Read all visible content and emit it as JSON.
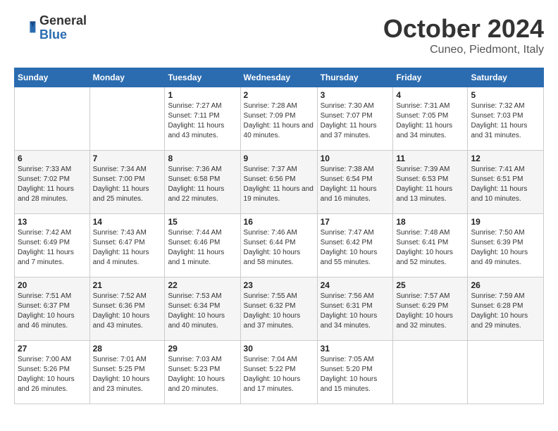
{
  "header": {
    "logo_general": "General",
    "logo_blue": "Blue",
    "title": "October 2024",
    "location": "Cuneo, Piedmont, Italy"
  },
  "weekdays": [
    "Sunday",
    "Monday",
    "Tuesday",
    "Wednesday",
    "Thursday",
    "Friday",
    "Saturday"
  ],
  "weeks": [
    [
      {
        "day": null
      },
      {
        "day": null
      },
      {
        "day": "1",
        "sunrise": "7:27 AM",
        "sunset": "7:11 PM",
        "daylight": "11 hours and 43 minutes."
      },
      {
        "day": "2",
        "sunrise": "7:28 AM",
        "sunset": "7:09 PM",
        "daylight": "11 hours and 40 minutes."
      },
      {
        "day": "3",
        "sunrise": "7:30 AM",
        "sunset": "7:07 PM",
        "daylight": "11 hours and 37 minutes."
      },
      {
        "day": "4",
        "sunrise": "7:31 AM",
        "sunset": "7:05 PM",
        "daylight": "11 hours and 34 minutes."
      },
      {
        "day": "5",
        "sunrise": "7:32 AM",
        "sunset": "7:03 PM",
        "daylight": "11 hours and 31 minutes."
      }
    ],
    [
      {
        "day": "6",
        "sunrise": "7:33 AM",
        "sunset": "7:02 PM",
        "daylight": "11 hours and 28 minutes."
      },
      {
        "day": "7",
        "sunrise": "7:34 AM",
        "sunset": "7:00 PM",
        "daylight": "11 hours and 25 minutes."
      },
      {
        "day": "8",
        "sunrise": "7:36 AM",
        "sunset": "6:58 PM",
        "daylight": "11 hours and 22 minutes."
      },
      {
        "day": "9",
        "sunrise": "7:37 AM",
        "sunset": "6:56 PM",
        "daylight": "11 hours and 19 minutes."
      },
      {
        "day": "10",
        "sunrise": "7:38 AM",
        "sunset": "6:54 PM",
        "daylight": "11 hours and 16 minutes."
      },
      {
        "day": "11",
        "sunrise": "7:39 AM",
        "sunset": "6:53 PM",
        "daylight": "11 hours and 13 minutes."
      },
      {
        "day": "12",
        "sunrise": "7:41 AM",
        "sunset": "6:51 PM",
        "daylight": "11 hours and 10 minutes."
      }
    ],
    [
      {
        "day": "13",
        "sunrise": "7:42 AM",
        "sunset": "6:49 PM",
        "daylight": "11 hours and 7 minutes."
      },
      {
        "day": "14",
        "sunrise": "7:43 AM",
        "sunset": "6:47 PM",
        "daylight": "11 hours and 4 minutes."
      },
      {
        "day": "15",
        "sunrise": "7:44 AM",
        "sunset": "6:46 PM",
        "daylight": "11 hours and 1 minute."
      },
      {
        "day": "16",
        "sunrise": "7:46 AM",
        "sunset": "6:44 PM",
        "daylight": "10 hours and 58 minutes."
      },
      {
        "day": "17",
        "sunrise": "7:47 AM",
        "sunset": "6:42 PM",
        "daylight": "10 hours and 55 minutes."
      },
      {
        "day": "18",
        "sunrise": "7:48 AM",
        "sunset": "6:41 PM",
        "daylight": "10 hours and 52 minutes."
      },
      {
        "day": "19",
        "sunrise": "7:50 AM",
        "sunset": "6:39 PM",
        "daylight": "10 hours and 49 minutes."
      }
    ],
    [
      {
        "day": "20",
        "sunrise": "7:51 AM",
        "sunset": "6:37 PM",
        "daylight": "10 hours and 46 minutes."
      },
      {
        "day": "21",
        "sunrise": "7:52 AM",
        "sunset": "6:36 PM",
        "daylight": "10 hours and 43 minutes."
      },
      {
        "day": "22",
        "sunrise": "7:53 AM",
        "sunset": "6:34 PM",
        "daylight": "10 hours and 40 minutes."
      },
      {
        "day": "23",
        "sunrise": "7:55 AM",
        "sunset": "6:32 PM",
        "daylight": "10 hours and 37 minutes."
      },
      {
        "day": "24",
        "sunrise": "7:56 AM",
        "sunset": "6:31 PM",
        "daylight": "10 hours and 34 minutes."
      },
      {
        "day": "25",
        "sunrise": "7:57 AM",
        "sunset": "6:29 PM",
        "daylight": "10 hours and 32 minutes."
      },
      {
        "day": "26",
        "sunrise": "7:59 AM",
        "sunset": "6:28 PM",
        "daylight": "10 hours and 29 minutes."
      }
    ],
    [
      {
        "day": "27",
        "sunrise": "7:00 AM",
        "sunset": "5:26 PM",
        "daylight": "10 hours and 26 minutes."
      },
      {
        "day": "28",
        "sunrise": "7:01 AM",
        "sunset": "5:25 PM",
        "daylight": "10 hours and 23 minutes."
      },
      {
        "day": "29",
        "sunrise": "7:03 AM",
        "sunset": "5:23 PM",
        "daylight": "10 hours and 20 minutes."
      },
      {
        "day": "30",
        "sunrise": "7:04 AM",
        "sunset": "5:22 PM",
        "daylight": "10 hours and 17 minutes."
      },
      {
        "day": "31",
        "sunrise": "7:05 AM",
        "sunset": "5:20 PM",
        "daylight": "10 hours and 15 minutes."
      },
      {
        "day": null
      },
      {
        "day": null
      }
    ]
  ],
  "labels": {
    "sunrise_label": "Sunrise:",
    "sunset_label": "Sunset:",
    "daylight_label": "Daylight:"
  }
}
